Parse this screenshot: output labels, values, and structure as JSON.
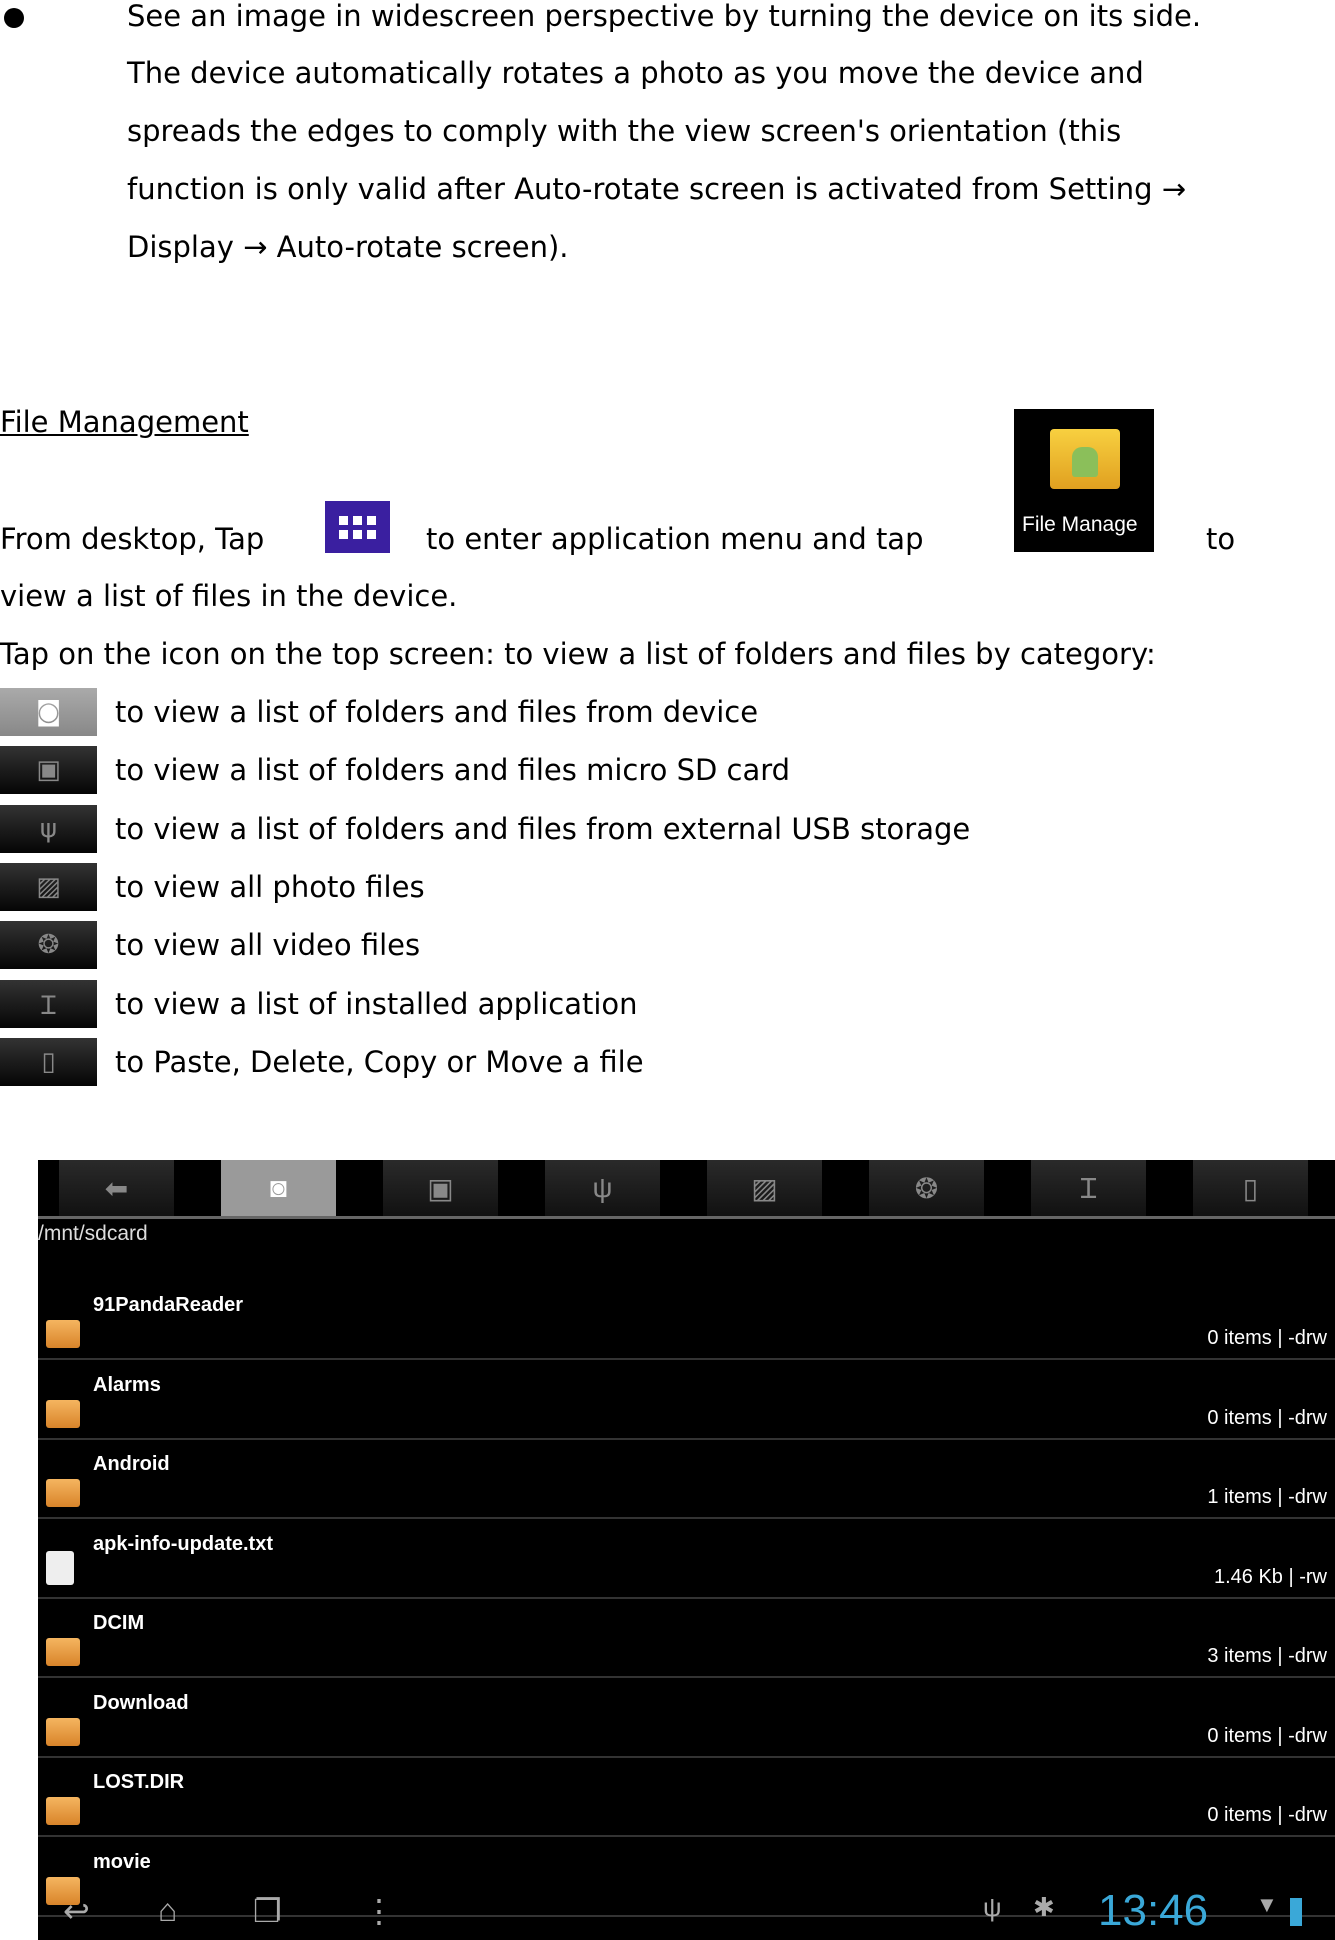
{
  "bullet": {
    "lines": [
      "See an image in widescreen perspective by turning the device on its side.",
      "The device automatically rotates a photo as you move the device and",
      "spreads the edges to comply with the view screen's orientation (this",
      "function is only valid after Auto-rotate screen is activated from Setting →",
      "Display → Auto-rotate screen)."
    ]
  },
  "section": {
    "title": "File Management",
    "intro_a": "From desktop, Tap",
    "intro_b": "to enter application menu and tap",
    "intro_c": "to",
    "intro_d": "view a list of files in the device.",
    "app_icon_label": "File Manage",
    "tap_line": "Tap on the icon on the top screen: to view a list of folders and files by category:",
    "icons": [
      {
        "icon": "device-icon",
        "text": "to view a list of folders and files from device"
      },
      {
        "icon": "sd-card-icon",
        "text": "to view a list of folders and files micro SD card"
      },
      {
        "icon": "usb-icon",
        "text": "to view a list of folders and files from external USB storage"
      },
      {
        "icon": "photo-icon",
        "text": "to view all photo files"
      },
      {
        "icon": "video-icon",
        "text": "to view all video files"
      },
      {
        "icon": "wrench-icon",
        "text": "to view a list of installed application"
      },
      {
        "icon": "file-icon",
        "text": "to Paste, Delete, Copy or Move a file"
      }
    ]
  },
  "screen": {
    "path": "/mnt/sdcard",
    "tabs": [
      "back-icon",
      "device-icon",
      "sd-card-icon",
      "usb-icon",
      "photo-icon",
      "video-icon",
      "wrench-icon",
      "file-icon"
    ],
    "selected_tab": 1,
    "rows": [
      {
        "name": "91PandaReader",
        "meta": "0 items | -drw",
        "type": "folder"
      },
      {
        "name": "Alarms",
        "meta": "0 items | -drw",
        "type": "folder"
      },
      {
        "name": "Android",
        "meta": "1 items | -drw",
        "type": "folder"
      },
      {
        "name": "apk-info-update.txt",
        "meta": "1.46 Kb  | -rw",
        "type": "file"
      },
      {
        "name": "DCIM",
        "meta": "3 items | -drw",
        "type": "folder"
      },
      {
        "name": "Download",
        "meta": "0 items | -drw",
        "type": "folder"
      },
      {
        "name": "LOST.DIR",
        "meta": "0 items | -drw",
        "type": "folder"
      },
      {
        "name": "movie",
        "meta": "",
        "type": "folder"
      }
    ],
    "clock": "13:46",
    "clock_color": "#3aa8d8"
  }
}
